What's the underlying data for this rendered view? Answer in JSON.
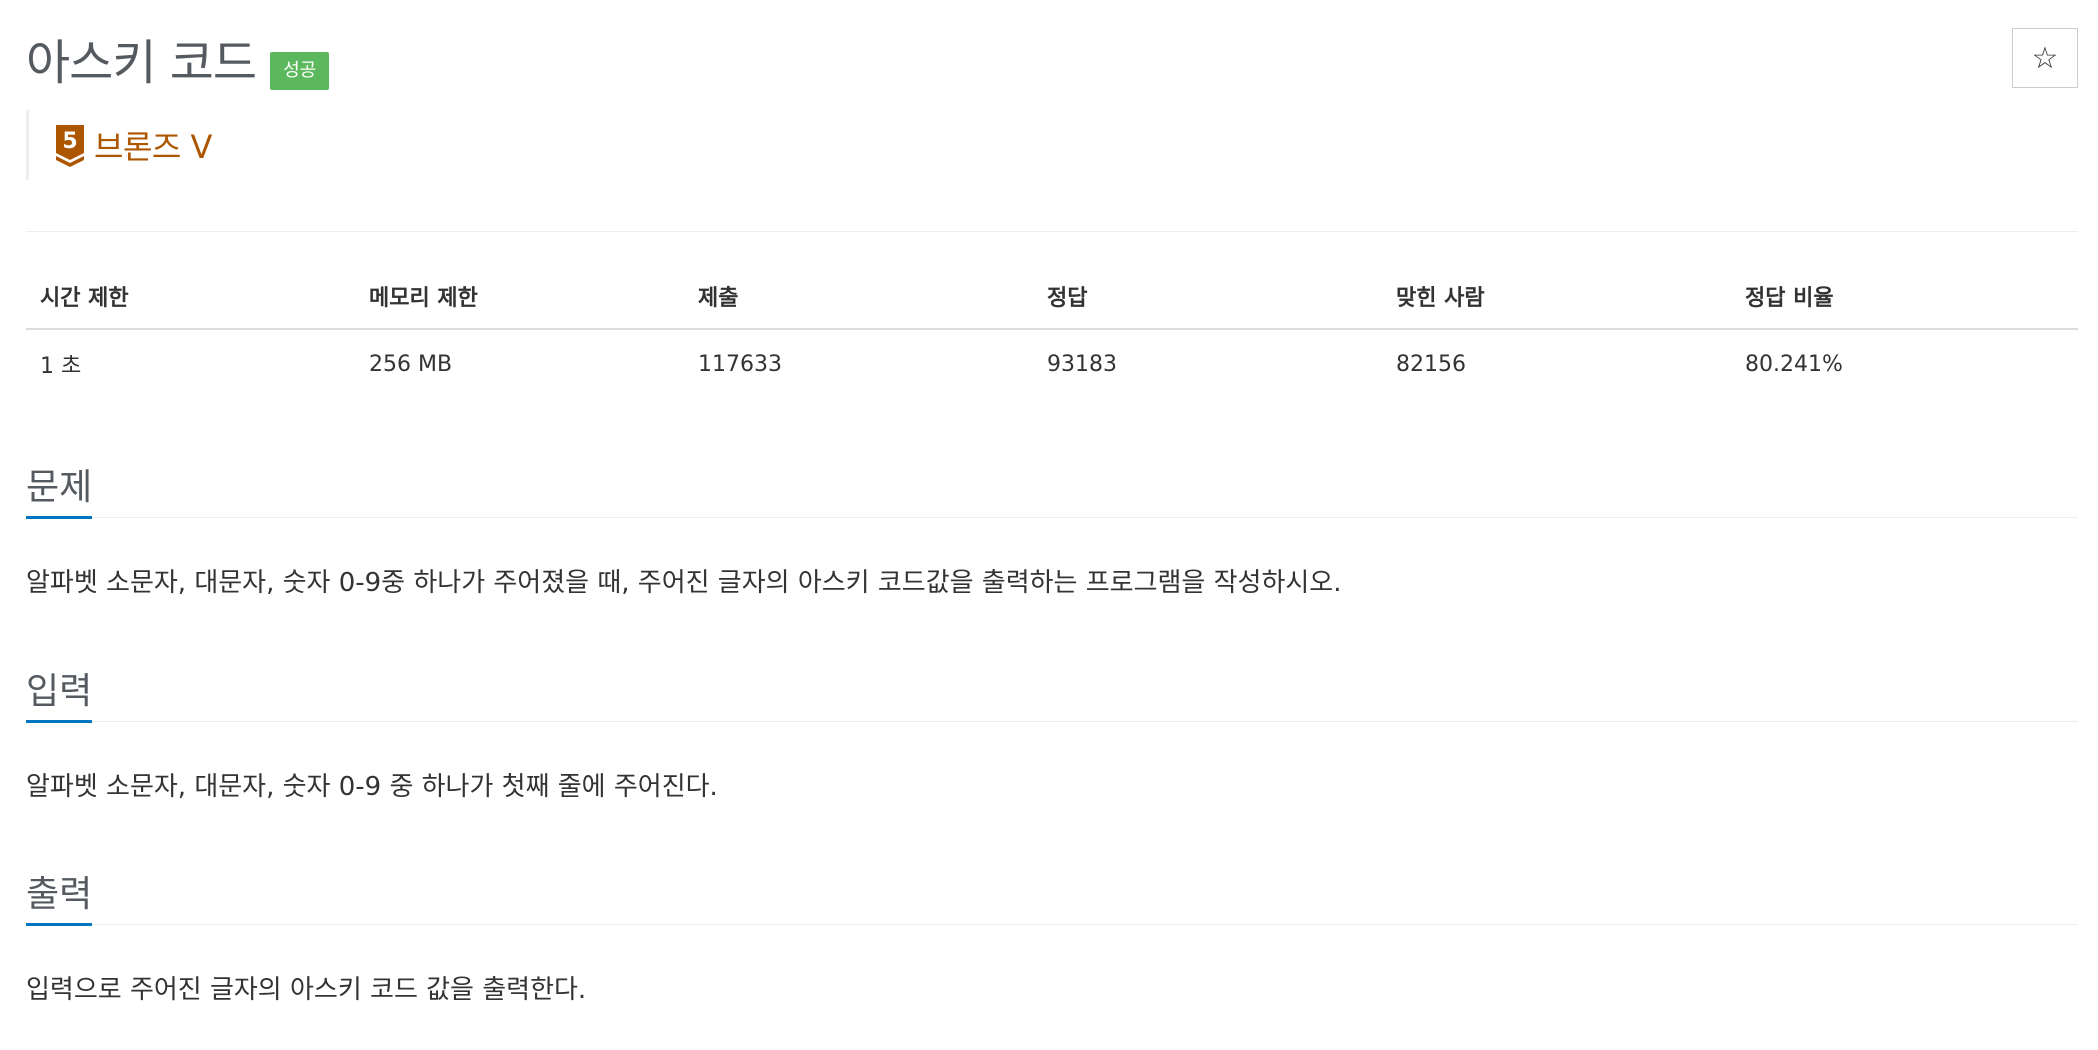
{
  "header": {
    "title": "아스키 코드",
    "result_badge": "성공",
    "star_icon": "☆",
    "tier": {
      "level": "5",
      "label": "브론즈 V",
      "color": "#ad5600"
    }
  },
  "info_table": {
    "headers": [
      "시간 제한",
      "메모리 제한",
      "제출",
      "정답",
      "맞힌 사람",
      "정답 비율"
    ],
    "values": [
      "1 초",
      "256 MB",
      "117633",
      "93183",
      "82156",
      "80.241%"
    ]
  },
  "sections": {
    "problem": {
      "title": "문제",
      "text": "알파벳 소문자, 대문자, 숫자 0-9중 하나가 주어졌을 때, 주어진 글자의 아스키 코드값을 출력하는 프로그램을 작성하시오."
    },
    "input": {
      "title": "입력",
      "text": "알파벳 소문자, 대문자, 숫자 0-9 중 하나가 첫째 줄에 주어진다."
    },
    "output": {
      "title": "출력",
      "text": "입력으로 주어진 글자의 아스키 코드 값을 출력한다."
    }
  },
  "colors": {
    "badge_success": "#5cb85c",
    "section_accent": "#0076c0",
    "tier_bronze": "#ad5600"
  }
}
